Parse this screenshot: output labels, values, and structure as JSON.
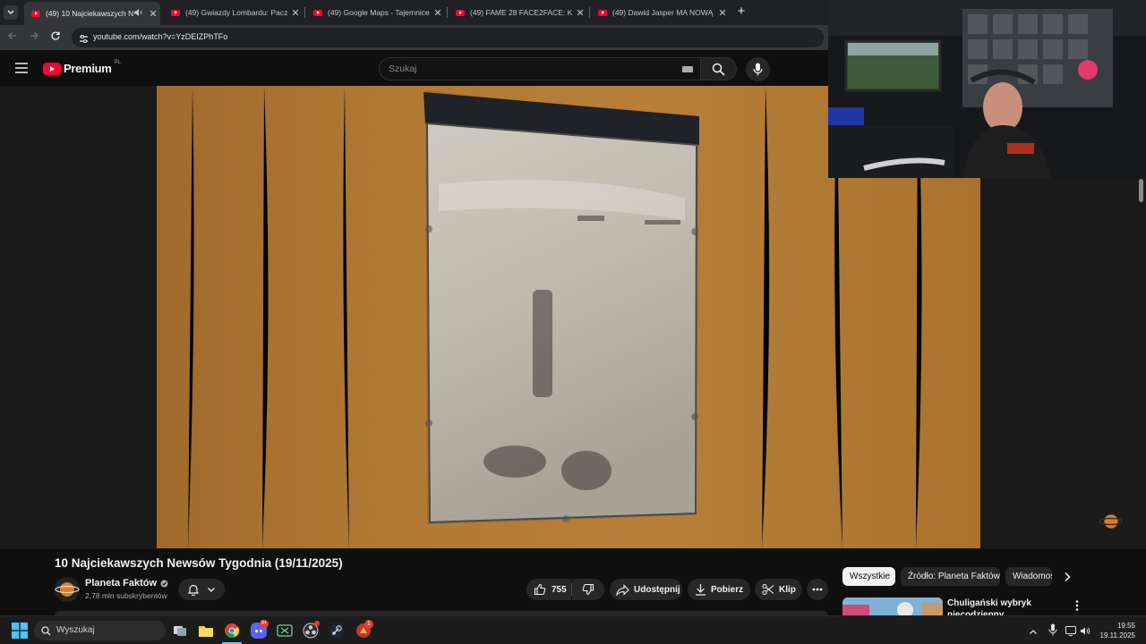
{
  "browser": {
    "tabs": [
      {
        "label": "(49) 10 Najciekawszych New",
        "active": true,
        "audio": true
      },
      {
        "label": "(49) Gwiazdy Lombardu: Paczka",
        "active": false
      },
      {
        "label": "(49) Google Maps - Tajemnice",
        "active": false
      },
      {
        "label": "(49) FAME 28 FACE2FACE: Krak",
        "active": false
      },
      {
        "label": "(49) Dawid Jasper MA NOWĄ D",
        "active": false
      }
    ],
    "url": "youtube.com/watch?v=YzDEIZPhTFo"
  },
  "youtube": {
    "logo_text": "Premium",
    "logo_region": "PL",
    "search_placeholder": "Szukaj"
  },
  "video": {
    "title": "10 Najciekawszych Newsów Tygodnia (19/11/2025)",
    "channel": "Planeta Faktów",
    "subscribers": "2,78 mln subskrybentów",
    "likes": "755",
    "share_label": "Udostępnij",
    "download_label": "Pobierz",
    "clip_label": "Klip"
  },
  "sidebar": {
    "chips": [
      "Wszystkie",
      "Źródło: Planeta Faktów",
      "Wiadomości"
    ],
    "rec_title_line1": "Chuligański wybryk",
    "rec_title_line2": "niecodzienny"
  },
  "taskbar": {
    "search_placeholder": "Wyszukaj",
    "time": "19:55",
    "date": "19.11.2025",
    "discord_badge": "9+",
    "app_badge": "1"
  },
  "colors": {
    "yt_red": "#ff0033",
    "bg": "#0f0f0f",
    "pill": "#272727"
  }
}
